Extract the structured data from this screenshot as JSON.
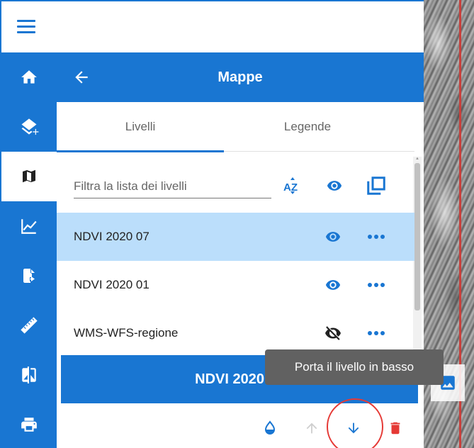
{
  "panel": {
    "title": "Mappe"
  },
  "tabs": [
    {
      "label": "Livelli"
    },
    {
      "label": "Legende"
    }
  ],
  "filter": {
    "placeholder": "Filtra la lista dei livelli",
    "sort_label": "AZ"
  },
  "layers": [
    {
      "name": "NDVI 2020 07",
      "visible": true,
      "selected": true
    },
    {
      "name": "NDVI 2020 01",
      "visible": true,
      "selected": false
    },
    {
      "name": "WMS-WFS-regione",
      "visible": false,
      "selected": false
    }
  ],
  "selected_layer": {
    "name": "NDVI 2020 07"
  },
  "tooltip": {
    "text": "Porta il livello in basso"
  },
  "colors": {
    "primary": "#1976d2",
    "selected_row": "#bbdefb",
    "danger": "#e53935"
  },
  "icons": {
    "rail": [
      "home-icon",
      "add-layers-icon",
      "map-icon",
      "chart-icon",
      "file-export-icon",
      "ruler-icon",
      "compare-icon",
      "print-icon"
    ],
    "tools": [
      "opacity-icon",
      "arrow-up-icon",
      "arrow-down-icon",
      "delete-icon"
    ]
  }
}
